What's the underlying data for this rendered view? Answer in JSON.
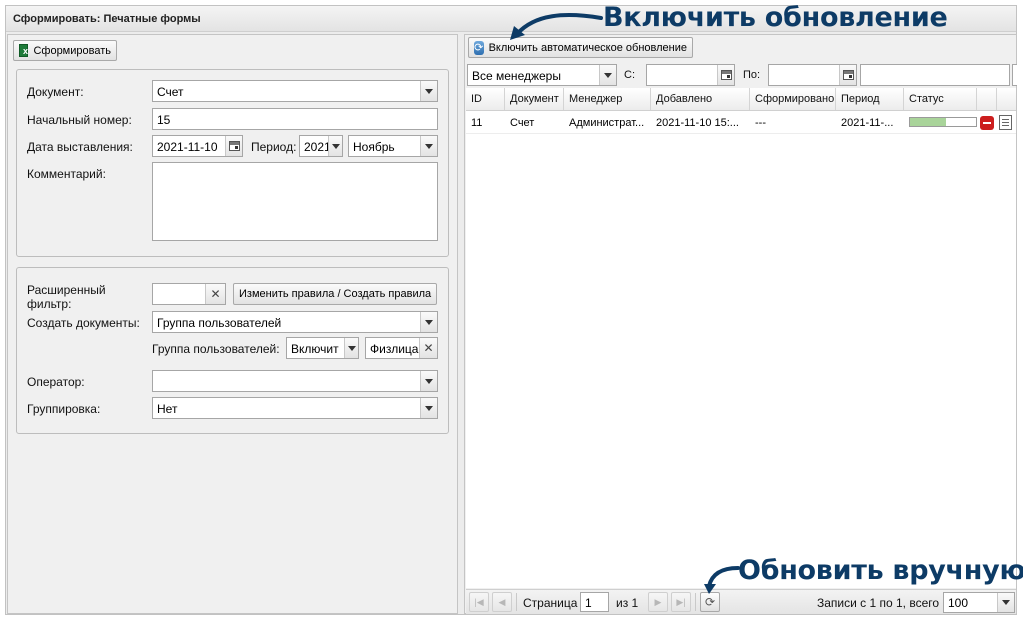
{
  "window": {
    "title": "Сформировать: Печатные формы"
  },
  "left_toolbar": {
    "form_button": "Сформировать"
  },
  "form": {
    "document_label": "Документ:",
    "document_value": "Счет",
    "start_number_label": "Начальный номер:",
    "start_number_value": "15",
    "issue_date_label": "Дата выставления:",
    "issue_date_value": "2021-11-10",
    "period_label": "Период:",
    "period_year": "2021",
    "period_month": "Ноябрь",
    "comment_label": "Комментарий:",
    "comment_value": ""
  },
  "filters": {
    "ext_filter_label": "Расширенный фильтр:",
    "ext_filter_value": "",
    "rules_button": "Изменить правила / Создать правила",
    "create_docs_label": "Создать документы:",
    "create_docs_value": "Группа пользователей",
    "user_group_label": "Группа пользователей:",
    "include_value": "Включит",
    "group_value": "Физлица",
    "operator_label": "Оператор:",
    "operator_value": "",
    "grouping_label": "Группировка:",
    "grouping_value": "Нет"
  },
  "right_toolbar": {
    "auto_refresh_button": "Включить автоматическое обновление"
  },
  "right_filters": {
    "managers_value": "Все менеджеры",
    "from_label": "С:",
    "from_value": "",
    "to_label": "По:",
    "to_value": "",
    "search_value": ""
  },
  "grid": {
    "columns": [
      "ID",
      "Документ",
      "Менеджер",
      "Добавлено",
      "Сформировано",
      "Период",
      "Статус"
    ],
    "rows": [
      {
        "id": "11",
        "document": "Счет",
        "manager": "Администрат...",
        "added": "2021-11-10 15:...",
        "formed": "---",
        "period": "2021-11-...",
        "status_progress": 0.55
      }
    ]
  },
  "pager": {
    "page_label": "Страница",
    "page_value": "1",
    "of_label": "из 1",
    "records_text": "Записи с 1 по 1, всего 1",
    "page_size": "100"
  },
  "annotations": {
    "enable_refresh": "Включить обновление",
    "manual_refresh": "Обновить вручную"
  },
  "colors": {
    "accent_text": "#0d3b66",
    "progress_fill": "#a9d49a",
    "delete_red": "#cc1e1e"
  }
}
